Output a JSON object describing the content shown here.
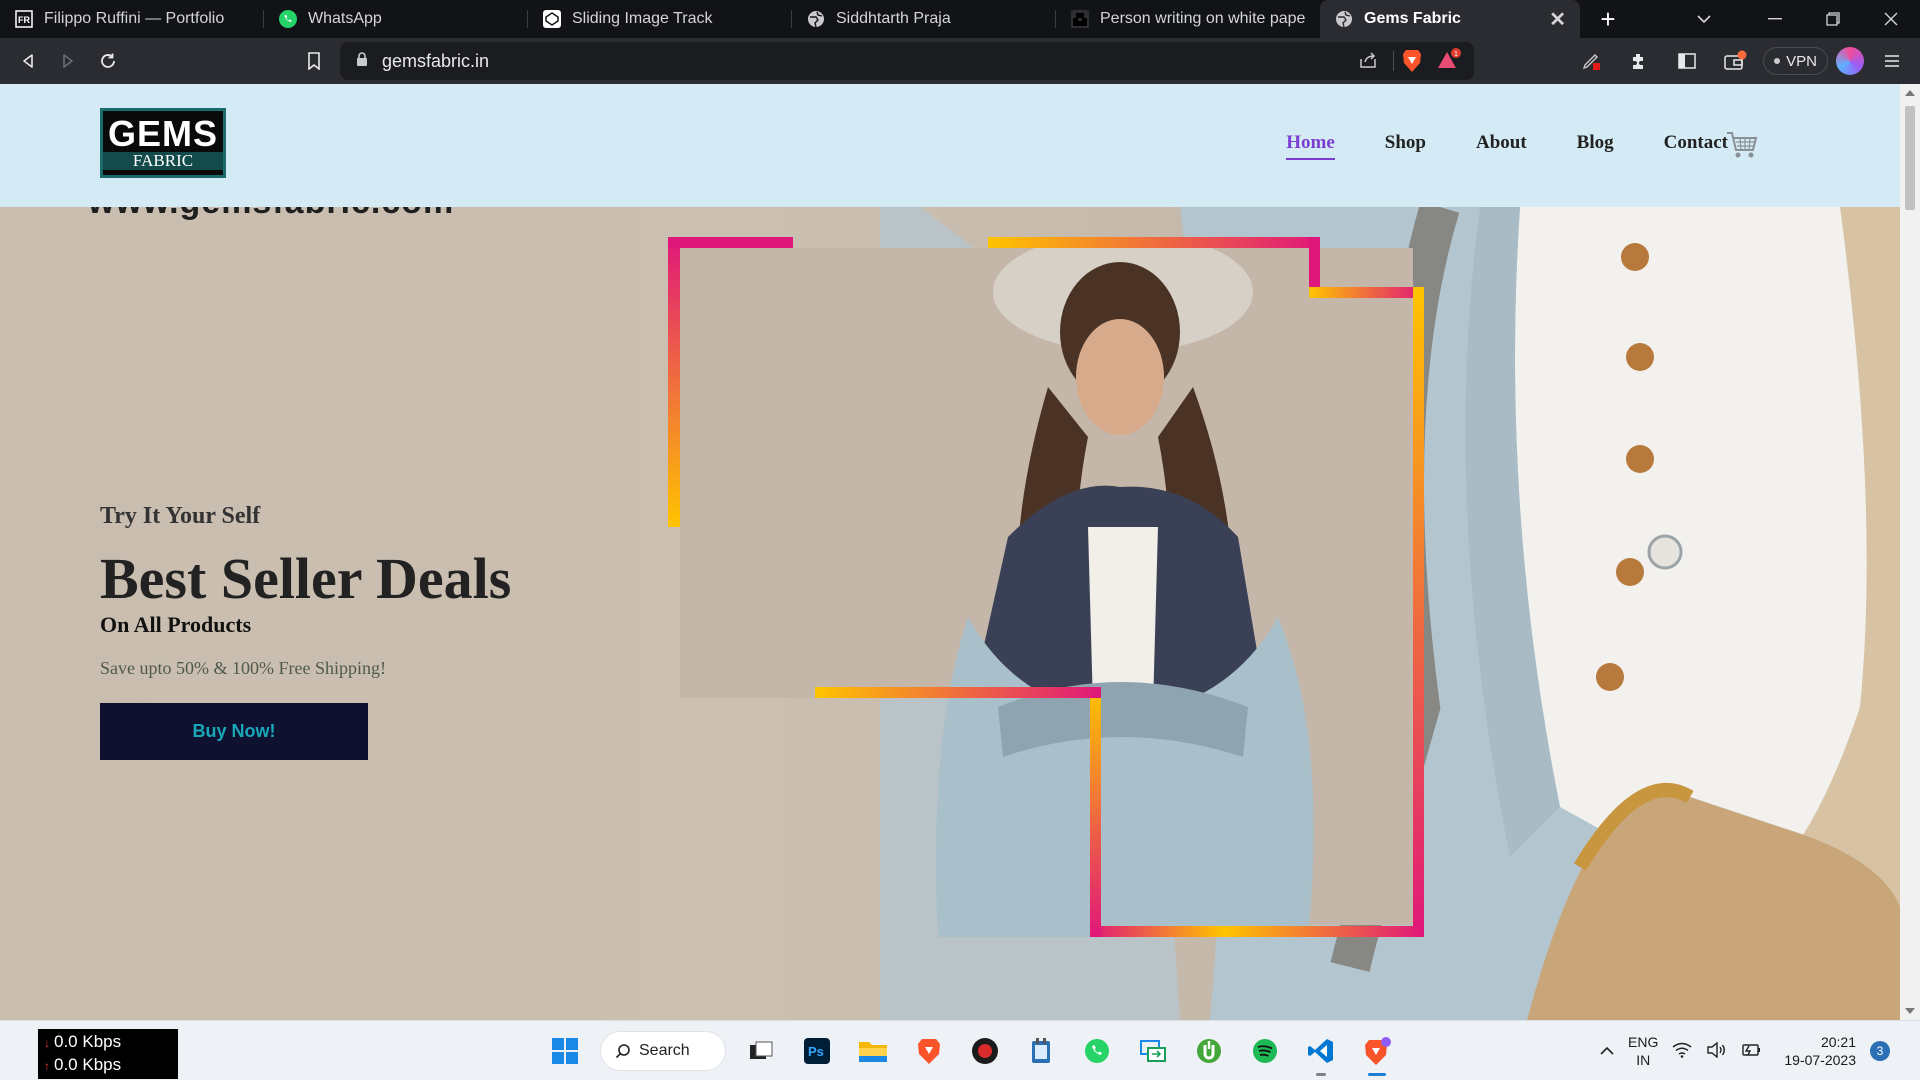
{
  "browser": {
    "tabs": [
      {
        "title": "Filippo Ruffini — Portfolio",
        "icon": "fr-favicon"
      },
      {
        "title": "WhatsApp",
        "icon": "whatsapp-icon"
      },
      {
        "title": "Sliding Image Track",
        "icon": "codepen-icon"
      },
      {
        "title": "Siddhtarth Praja",
        "icon": "globe-icon"
      },
      {
        "title": "Person writing on white paper pl",
        "icon": "unsplash-icon"
      },
      {
        "title": "Gems Fabric",
        "icon": "globe-icon",
        "active": true
      }
    ],
    "url": "gemsfabric.in",
    "vpn_label": "VPN",
    "rewards_badge": "1"
  },
  "site": {
    "logo": {
      "line1": "GEMS",
      "line2": "FABRIC"
    },
    "nav": [
      {
        "label": "Home",
        "active": true
      },
      {
        "label": "Shop"
      },
      {
        "label": "About"
      },
      {
        "label": "Blog"
      },
      {
        "label": "Contact"
      }
    ],
    "hero": {
      "watermark": "www.gemsfabric.com",
      "subtitle": "Try It Your Self",
      "title": "Best Seller Deals",
      "tagline": "On All Products",
      "description": "Save upto 50% & 100% Free Shipping!",
      "cta": "Buy Now!"
    }
  },
  "taskbar": {
    "net_down": "0.0 Kbps",
    "net_up": "0.0 Kbps",
    "search_label": "Search",
    "lang_line1": "ENG",
    "lang_line2": "IN",
    "time": "20:21",
    "date": "19-07-2023",
    "notification_count": "3"
  },
  "colors": {
    "header_bg": "#d4ebf5",
    "nav_active": "#7a3fd0",
    "cta_bg": "#0e1130",
    "cta_text": "#19a8b8",
    "frame_gradient": [
      "#e0177a",
      "#ffc400"
    ]
  }
}
